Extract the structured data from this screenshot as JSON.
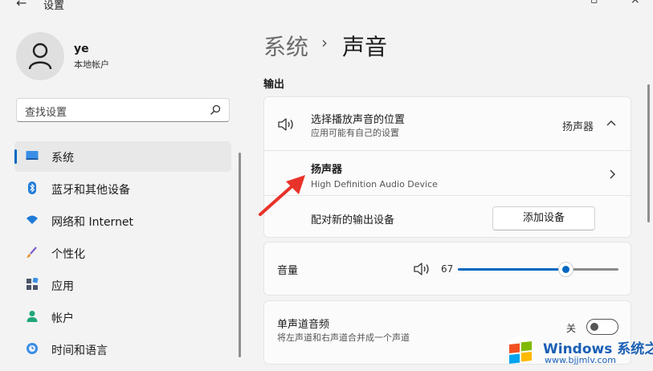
{
  "window": {
    "title": "设置"
  },
  "user": {
    "name": "ye",
    "account_type": "本地帐户"
  },
  "search": {
    "placeholder": "查找设置"
  },
  "nav": {
    "items": [
      {
        "label": "系统",
        "icon": "monitor-icon",
        "active": true
      },
      {
        "label": "蓝牙和其他设备",
        "icon": "bluetooth-icon"
      },
      {
        "label": "网络和 Internet",
        "icon": "wifi-icon"
      },
      {
        "label": "个性化",
        "icon": "brush-icon"
      },
      {
        "label": "应用",
        "icon": "apps-icon"
      },
      {
        "label": "帐户",
        "icon": "account-icon"
      },
      {
        "label": "时间和语言",
        "icon": "clock-globe-icon"
      }
    ]
  },
  "breadcrumb": {
    "parent": "系统",
    "separator": "›",
    "current": "声音"
  },
  "output": {
    "section_title": "输出",
    "choose": {
      "title": "选择播放声音的位置",
      "subtitle": "应用可能有自己的设置",
      "value": "扬声器"
    },
    "device": {
      "name": "扬声器",
      "description": "High Definition Audio Device"
    },
    "pair": {
      "label": "配对新的输出设备",
      "button": "添加设备"
    }
  },
  "volume": {
    "label": "音量",
    "value": "67",
    "level": 0.67
  },
  "mono": {
    "title": "单声道音频",
    "subtitle": "将左声道和右声道合并成一个声道",
    "state": "关",
    "on": false
  },
  "watermark": {
    "title": "Windows 系统之家",
    "url": "www.bjjmlv.com"
  },
  "colors": {
    "accent": "#0067c0",
    "arrow": "#e8332a",
    "watermark": "#1a5fb4"
  }
}
